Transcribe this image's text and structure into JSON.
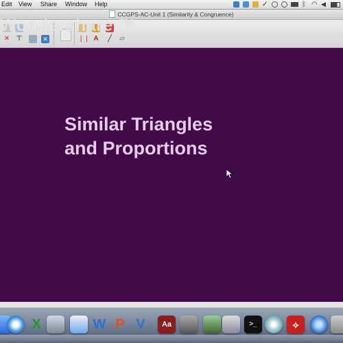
{
  "menubar": {
    "items": [
      "Edit",
      "View",
      "Share",
      "Window",
      "Help"
    ]
  },
  "window": {
    "title": "CCGPS-AC-Unit 1 (Similarity & Congruence)"
  },
  "watermark": {
    "text": "Wondershare ™"
  },
  "slide": {
    "title_line1": "Similar Triangles",
    "title_line2": "and Proportions",
    "background": "#3f0a45",
    "text_color": "#e6cbea"
  },
  "dock": {
    "icons": [
      "finder-icon",
      "safari-icon",
      "excel-icon",
      "facetime-icon",
      "pages-icon",
      "word-icon",
      "powerpoint-icon",
      "visio-icon",
      "dictionary-icon",
      "utility-icon",
      "game-icon",
      "preview-icon",
      "terminal-icon",
      "dvd-icon",
      "acrobat-icon",
      "quicktime-icon"
    ]
  }
}
